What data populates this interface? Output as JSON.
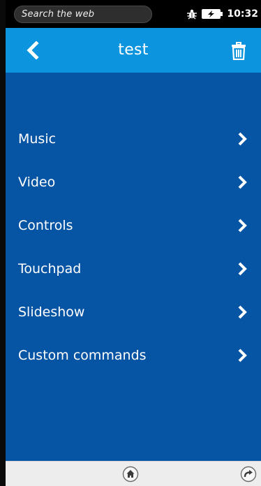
{
  "status_bar": {
    "search_placeholder": "Search the web",
    "time": "10:32",
    "icons": [
      "bug-icon",
      "battery-charging-icon"
    ]
  },
  "header": {
    "title": "test",
    "back_icon": "chevron-left-icon",
    "delete_icon": "trash-icon",
    "color": "#0c95de"
  },
  "menu": {
    "background": "#0654a4",
    "items": [
      {
        "label": "Music"
      },
      {
        "label": "Video"
      },
      {
        "label": "Controls"
      },
      {
        "label": "Touchpad"
      },
      {
        "label": "Slideshow"
      },
      {
        "label": "Custom commands"
      }
    ],
    "item_icon": "chevron-right-icon"
  },
  "bottom_bar": {
    "icons": [
      "home-icon",
      "rotate-icon"
    ]
  }
}
